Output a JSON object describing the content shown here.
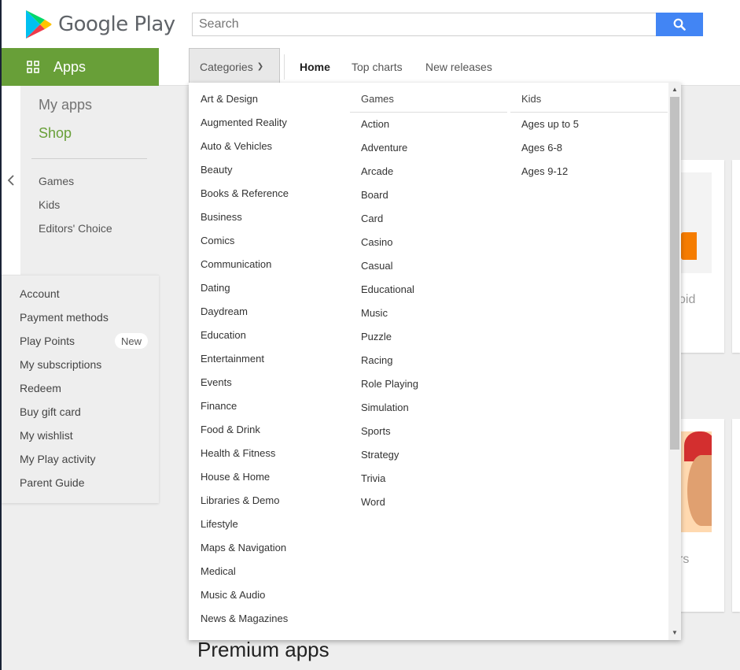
{
  "header": {
    "logo_text": "Google Play",
    "search_placeholder": "Search"
  },
  "nav": {
    "apps_label": "Apps",
    "categories_label": "Categories",
    "links": [
      "Home",
      "Top charts",
      "New releases"
    ]
  },
  "sidebar": {
    "my_apps": "My apps",
    "shop": "Shop",
    "sub_items": [
      "Games",
      "Kids",
      "Editors' Choice"
    ],
    "account_items": [
      "Account",
      "Payment methods",
      "Play Points",
      "My subscriptions",
      "Redeem",
      "Buy gift card",
      "My wishlist",
      "My Play activity",
      "Parent Guide"
    ],
    "new_badge": "New"
  },
  "dropdown": {
    "apps_categories": [
      "Art & Design",
      "Augmented Reality",
      "Auto & Vehicles",
      "Beauty",
      "Books & Reference",
      "Business",
      "Comics",
      "Communication",
      "Dating",
      "Daydream",
      "Education",
      "Entertainment",
      "Events",
      "Finance",
      "Food & Drink",
      "Health & Fitness",
      "House & Home",
      "Libraries & Demo",
      "Lifestyle",
      "Maps & Navigation",
      "Medical",
      "Music & Audio",
      "News & Magazines"
    ],
    "games_heading": "Games",
    "games_categories": [
      "Action",
      "Adventure",
      "Arcade",
      "Board",
      "Card",
      "Casino",
      "Casual",
      "Educational",
      "Music",
      "Puzzle",
      "Racing",
      "Role Playing",
      "Simulation",
      "Sports",
      "Strategy",
      "Trivia",
      "Word"
    ],
    "kids_heading": "Kids",
    "kids_categories": [
      "Ages up to 5",
      "Ages 6-8",
      "Ages 9-12"
    ]
  },
  "background": {
    "section_title": "Premium apps",
    "fragment_1": "oid",
    "fragment_2": "rs"
  },
  "colors": {
    "apps_green": "#689f38",
    "search_blue": "#4285f4"
  }
}
